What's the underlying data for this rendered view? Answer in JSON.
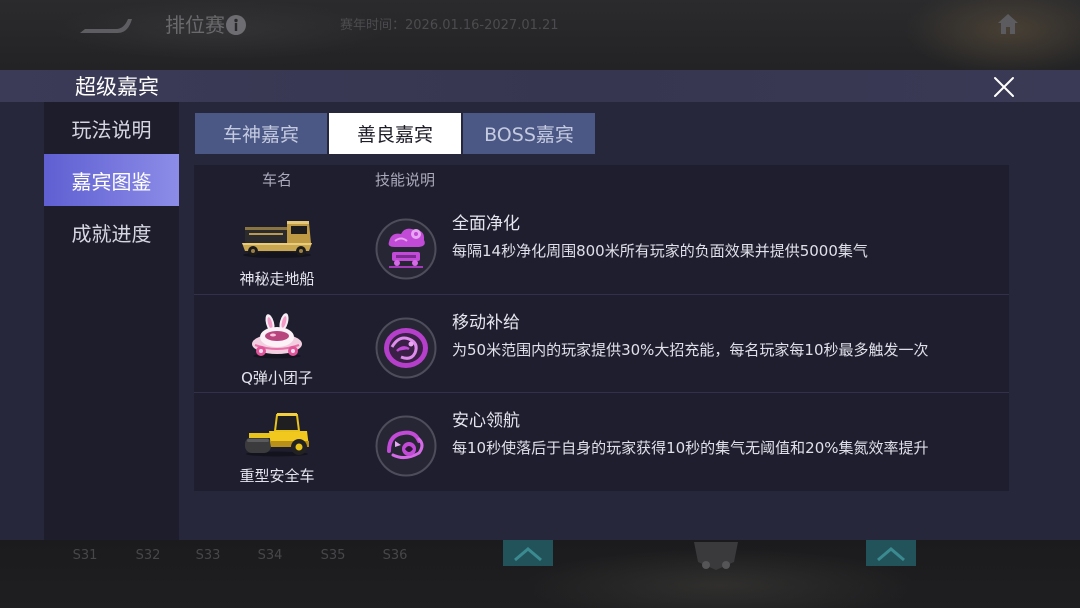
{
  "theme": {
    "modal_bg": "#27273b",
    "sidebar_selected_from": "#5f5fd2",
    "sidebar_selected_to": "#8c8ce8",
    "tab_bg": "#4b5885",
    "tab_selected_bg": "#ffffff",
    "skill_accent": "#c14bd6",
    "bottom_teal": "#22535a"
  },
  "background": {
    "top_bar": {
      "mode_title": "排位赛",
      "season_time": "赛年时间：2026.01.16-2027.01.21",
      "icons": {
        "logo": "game-logo-icon",
        "info": "info-icon",
        "home": "home-icon"
      }
    },
    "season_tabs": [
      "S31",
      "S32",
      "S33",
      "S34",
      "S35",
      "S36"
    ],
    "icons": {
      "arrow": "chevron-up-icon",
      "emblem": "rank-emblem-icon"
    }
  },
  "modal": {
    "title": "超级嘉宾",
    "close_icon": "close-icon",
    "sidebar": {
      "items": [
        {
          "label": "玩法说明",
          "selected": false
        },
        {
          "label": "嘉宾图鉴",
          "selected": true
        },
        {
          "label": "成就进度",
          "selected": false
        }
      ]
    },
    "tabs": [
      {
        "label": "车神嘉宾",
        "selected": false
      },
      {
        "label": "善良嘉宾",
        "selected": true
      },
      {
        "label": "BOSS嘉宾",
        "selected": false
      }
    ],
    "table": {
      "headers": {
        "car_name": "车名",
        "skill": "技能说明"
      },
      "rows": [
        {
          "car_name": "神秘走地船",
          "car_image": "land-boat-car-icon",
          "skill_icon": "purify-skill-icon",
          "skill_title": "全面净化",
          "skill_desc": "每隔14秒净化周围800米所有玩家的负面效果并提供5000集气"
        },
        {
          "car_name": "Q弹小团子",
          "car_image": "bunny-car-icon",
          "skill_icon": "mobile-supply-skill-icon",
          "skill_title": "移动补给",
          "skill_desc": "为50米范围内的玩家提供30%大招充能，每名玩家每10秒最多触发一次"
        },
        {
          "car_name": "重型安全车",
          "car_image": "road-roller-car-icon",
          "skill_icon": "safe-navigation-skill-icon",
          "skill_title": "安心领航",
          "skill_desc": "每10秒使落后于自身的玩家获得10秒的集气无阈值和20%集氮效率提升"
        }
      ]
    }
  }
}
